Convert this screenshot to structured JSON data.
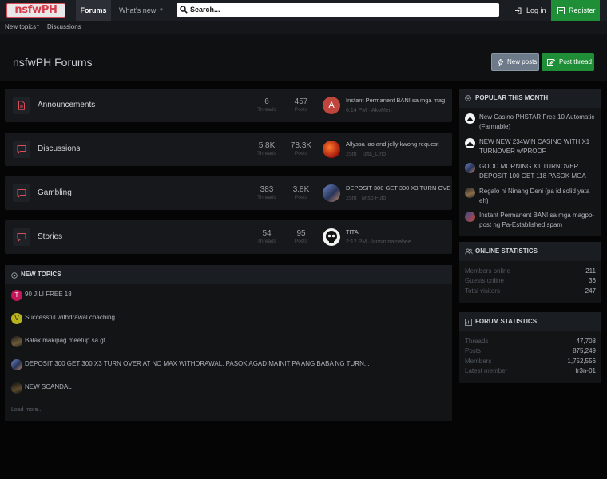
{
  "header": {
    "logo": "nsfwPH",
    "nav": {
      "forums": "Forums",
      "whats_new": "What's new"
    },
    "search_placeholder": "Search...",
    "login": "Log in",
    "register": "Register"
  },
  "subnav": {
    "new_topics": "New topics",
    "discussions": "Discussions"
  },
  "page": {
    "title": "nsfwPH Forums",
    "new_posts": "New posts",
    "post_thread": "Post thread"
  },
  "forums": [
    {
      "name": "Announcements",
      "threads": "6",
      "posts": "457",
      "threads_label": "Threads",
      "posts_label": "Posts",
      "last_title": "Instant Permanent BAN! sa mga mag",
      "last_meta": "6:14 PM · AkoMen",
      "avatar_letter": "A"
    },
    {
      "name": "Discussions",
      "threads": "5.8K",
      "posts": "78.3K",
      "threads_label": "Threads",
      "posts_label": "Posts",
      "last_title": "Allyssa lao and jelly kwong request",
      "last_meta": "25m · Tata_Lino",
      "avatar_letter": ""
    },
    {
      "name": "Gambling",
      "threads": "383",
      "posts": "3.8K",
      "threads_label": "Threads",
      "posts_label": "Posts",
      "last_title": "DEPOSIT 300 GET 300 X3 TURN OVE",
      "last_meta": "25m · Miso Fulo",
      "avatar_letter": ""
    },
    {
      "name": "Stories",
      "threads": "54",
      "posts": "95",
      "threads_label": "Threads",
      "posts_label": "Posts",
      "last_title": "TITA",
      "last_meta": "2:12 PM · lansinmamabee",
      "avatar_letter": ""
    }
  ],
  "new_topics": {
    "title": "NEW TOPICS",
    "items": [
      {
        "title": "90 JILI FREE 18",
        "avatar_letter": "T"
      },
      {
        "title": "Successful withdrawal chaching",
        "avatar_letter": "V"
      },
      {
        "title": "Balak makipag meetup sa gf",
        "avatar_letter": ""
      },
      {
        "title": "DEPOSIT 300 GET 300 X3 TURN OVER AT NO MAX WITHDRAWAL. PASOK AGAD MAINIT PA ANG BABA NG TURN...",
        "avatar_letter": ""
      },
      {
        "title": "NEW SCANDAL",
        "avatar_letter": ""
      }
    ],
    "load_more": "Load more..."
  },
  "popular": {
    "title": "POPULAR THIS MONTH",
    "items": [
      "New Casino PHSTAR Free 10 Automatic (Farmable)",
      "NEW NEW 234WIN CASINO WITH X1 TURNOVER w/PROOF",
      "GOOD MORNING X1 TURNOVER DEPOSIT 100 GET 118 PASOK MGA",
      "Regalo ni Ninang Deni (pa id solid yata eh)",
      "Instant Permanent BAN! sa mga magpo-post ng Pa-Established spam"
    ]
  },
  "online": {
    "title": "ONLINE STATISTICS",
    "rows": [
      {
        "label": "Members online",
        "value": "211"
      },
      {
        "label": "Guests online",
        "value": "36"
      },
      {
        "label": "Total visitors",
        "value": "247"
      }
    ]
  },
  "forum_stats": {
    "title": "FORUM STATISTICS",
    "rows": [
      {
        "label": "Threads",
        "value": "47,708"
      },
      {
        "label": "Posts",
        "value": "875,249"
      },
      {
        "label": "Members",
        "value": "1,752,556"
      },
      {
        "label": "Latest member",
        "value": "fr3n-01"
      }
    ]
  },
  "colors": {
    "accent_green": "#1f8f37",
    "forum_icon_red": "#d94c5a",
    "new_posts_btn": "#6c7a89"
  }
}
